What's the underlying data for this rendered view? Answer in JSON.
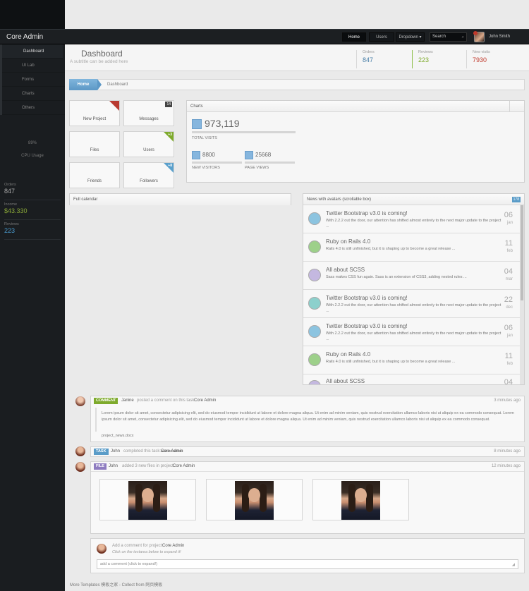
{
  "app": {
    "brand": "Core Admin"
  },
  "topnav": {
    "home": "Home",
    "users": "Users",
    "dropdown": "Dropdown ▾",
    "search_placeholder": "Search",
    "username": "John Smith"
  },
  "sidebar": {
    "items": [
      {
        "label": "Dashboard"
      },
      {
        "label": "UI Lab"
      },
      {
        "label": "Forms"
      },
      {
        "label": "Charts"
      },
      {
        "label": "Others"
      }
    ],
    "cpu_percent": "89%",
    "cpu_label": "CPU Usage",
    "stats": [
      {
        "label": "Orders",
        "value": "847",
        "color": "#aaaaaa"
      },
      {
        "label": "Income",
        "value": "$43.330",
        "color": "#8aa838"
      },
      {
        "label": "Reviews",
        "value": "223",
        "color": "#4a9cd0"
      }
    ]
  },
  "header": {
    "title": "Dashboard",
    "subtitle": "A subtitle can be added here",
    "stats": [
      {
        "label": "Orders",
        "value": "847",
        "color": "#4a7fa8"
      },
      {
        "label": "Reviews",
        "value": "223",
        "color": "#7eaa2c"
      },
      {
        "label": "New visits",
        "value": "7930",
        "color": "#c0392b"
      }
    ]
  },
  "breadcrumb": {
    "home": "Home",
    "current": "Dashboard"
  },
  "tiles": [
    {
      "label": "New Project",
      "badge": "",
      "color": "#b83a30"
    },
    {
      "label": "Messages",
      "badge": "14",
      "color": "#444444"
    },
    {
      "label": "Files",
      "badge": "",
      "color": ""
    },
    {
      "label": "Users",
      "badge": "+3",
      "color": "#7eaa2c"
    },
    {
      "label": "Friends",
      "badge": "",
      "color": ""
    },
    {
      "label": "Followers",
      "badge": "+8",
      "color": "#5aa0cc"
    }
  ],
  "charts": {
    "title": "Charts",
    "total_visits": "973,119",
    "total_label": "TOTAL VISITS",
    "new_visitors": "8800",
    "new_visitors_label": "NEW VISITORS",
    "page_views": "25668",
    "page_views_label": "PAGE VIEWS"
  },
  "calendar": {
    "title": "Full calendar"
  },
  "news": {
    "title": "News with avatars (scrollable box)",
    "count": "178",
    "items": [
      {
        "title": "Twitter Bootstrap v3.0 is coming!",
        "desc": "With 2.2.2 out the door, our attention has shifted almost entirely to the next major update to the project ...",
        "day": "06",
        "month": "jan",
        "color": "#8cc4e0"
      },
      {
        "title": "Ruby on Rails 4.0",
        "desc": "Rails 4.0 is still unfinished, but it is shaping up to become a great release ...",
        "day": "11",
        "month": "feb",
        "color": "#9dd08a"
      },
      {
        "title": "All about SCSS",
        "desc": "Sass makes CSS fun again. Sass is an extension of CSS3, adding nested rules ...",
        "day": "04",
        "month": "mar",
        "color": "#c4b8e0"
      },
      {
        "title": "Twitter Bootstrap v3.0 is coming!",
        "desc": "With 2.2.2 out the door, our attention has shifted almost entirely to the next major update to the project ...",
        "day": "22",
        "month": "dec",
        "color": "#8cd0cc"
      },
      {
        "title": "Twitter Bootstrap v3.0 is coming!",
        "desc": "With 2.2.2 out the door, our attention has shifted almost entirely to the next major update to the project ...",
        "day": "06",
        "month": "jan",
        "color": "#8cc4e0"
      },
      {
        "title": "Ruby on Rails 4.0",
        "desc": "Rails 4.0 is still unfinished, but it is shaping up to become a great release ...",
        "day": "11",
        "month": "feb",
        "color": "#9dd08a"
      },
      {
        "title": "All about SCSS",
        "desc": "",
        "day": "04",
        "month": "",
        "color": "#c4b8e0"
      }
    ]
  },
  "timeline": [
    {
      "tag": "COMMENT",
      "tag_color": "#7eaa2c",
      "user": "Janine",
      "action": "posted a comment on this task:",
      "target": "Core Admin",
      "time": "3 minutes ago",
      "body": "Lorem ipsum dolor sit amet, consectetur adipisicing elit, sed do eiusmod tempor incididunt ut labore et dolore magna aliqua. Ut enim ad minim veniam, quis nostrud exercitation ullamco laboris nisi ut aliquip ex ea commodo consequat. Lorem ipsum dolor sit amet, consectetur adipisicing elit, sed do eiusmod tempor incididunt ut labore et dolore magna aliqua. Ut enim ad minim veniam, quis nostrud exercitation ullamco laboris nisi ut aliquip ex ea commodo consequat.",
      "attachment": "project_news.docx"
    },
    {
      "tag": "TASK",
      "tag_color": "#5a9cc8",
      "user": "John",
      "action": "completed this task:",
      "target": "Core Admin",
      "time": "8 minutes ago"
    },
    {
      "tag": "FILE",
      "tag_color": "#8e7cc0",
      "user": "John",
      "action": "added 3 new files in project:",
      "target": "Core Admin",
      "time": "12 minutes ago"
    }
  ],
  "comment_box": {
    "prompt": "Add a comment for project:",
    "project": "Core Admin",
    "hint": "Click on the textarea below to expand it!",
    "placeholder": "add a comment (click to expand!)"
  },
  "footer": {
    "text": "More Templates 模板之家 - Collect from 网页模板"
  }
}
